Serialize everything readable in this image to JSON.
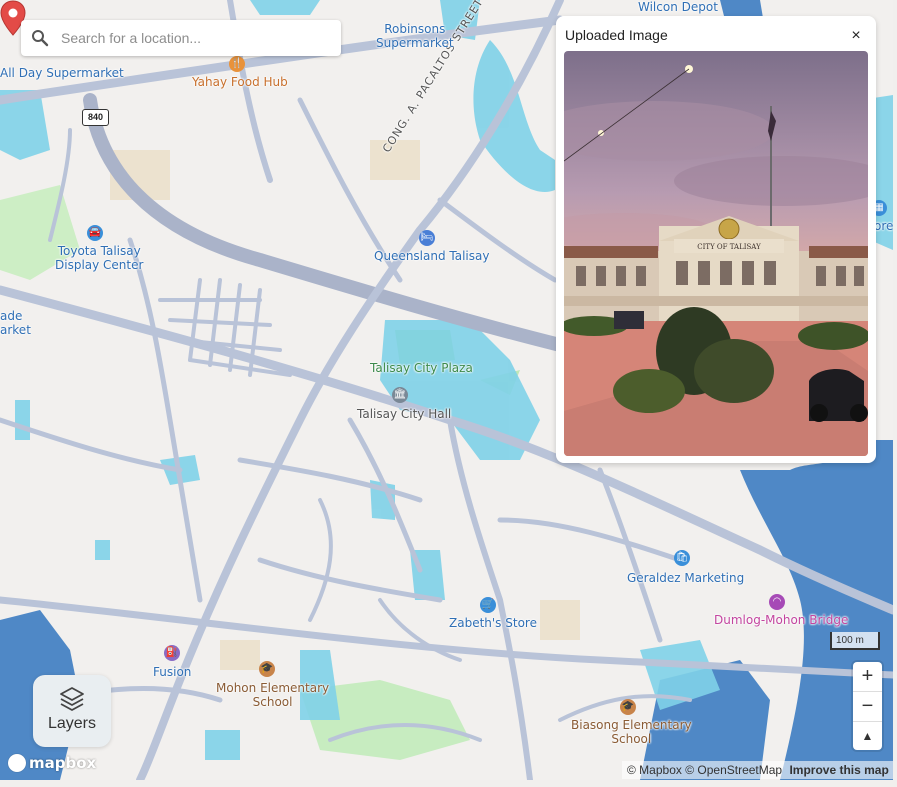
{
  "search": {
    "placeholder": "Search for a location..."
  },
  "panel": {
    "title": "Uploaded Image",
    "close_label": "×"
  },
  "photo": {
    "sign_text": "CITY OF TALISAY"
  },
  "layers": {
    "label": "Layers"
  },
  "zoom": {
    "in": "+",
    "out": "−",
    "compass": "▲"
  },
  "scale": {
    "label": "100 m"
  },
  "attribution": {
    "mapbox": "© Mapbox",
    "osm": "© OpenStreetMap",
    "improve": "Improve this map"
  },
  "logo": {
    "text": "mapbox"
  },
  "road_shield": "840",
  "street_label": "CONG. A. PACALTOS STREET",
  "places": {
    "robinsons": "Robinsons\nSupermarket",
    "wilcon": "Wilcon Depot",
    "allday": "All Day Supermarket",
    "yahay": "Yahay Food Hub",
    "toyota": "Toyota Talisay\nDisplay Center",
    "queensland": "Queensland Talisay",
    "plaza": "Talisay City Plaza",
    "cityhall": "Talisay City Hall",
    "trade": "ade\narket",
    "geraldez": "Geraldez Marketing",
    "zabeth": "Zabeth's Store",
    "dumlog": "Dumlog-Mohon Bridge",
    "fusion": "Fusion",
    "mohon": "Mohon Elementary\nSchool",
    "biasong": "Biasong Elementary\nSchool",
    "edge_right": "ore"
  },
  "colors": {
    "flood_light": "#7fd1e8",
    "flood_deep": "#4a86c8",
    "road": "#b9c3d8",
    "park": "#c7ecc0",
    "marker": "#e34b47"
  }
}
